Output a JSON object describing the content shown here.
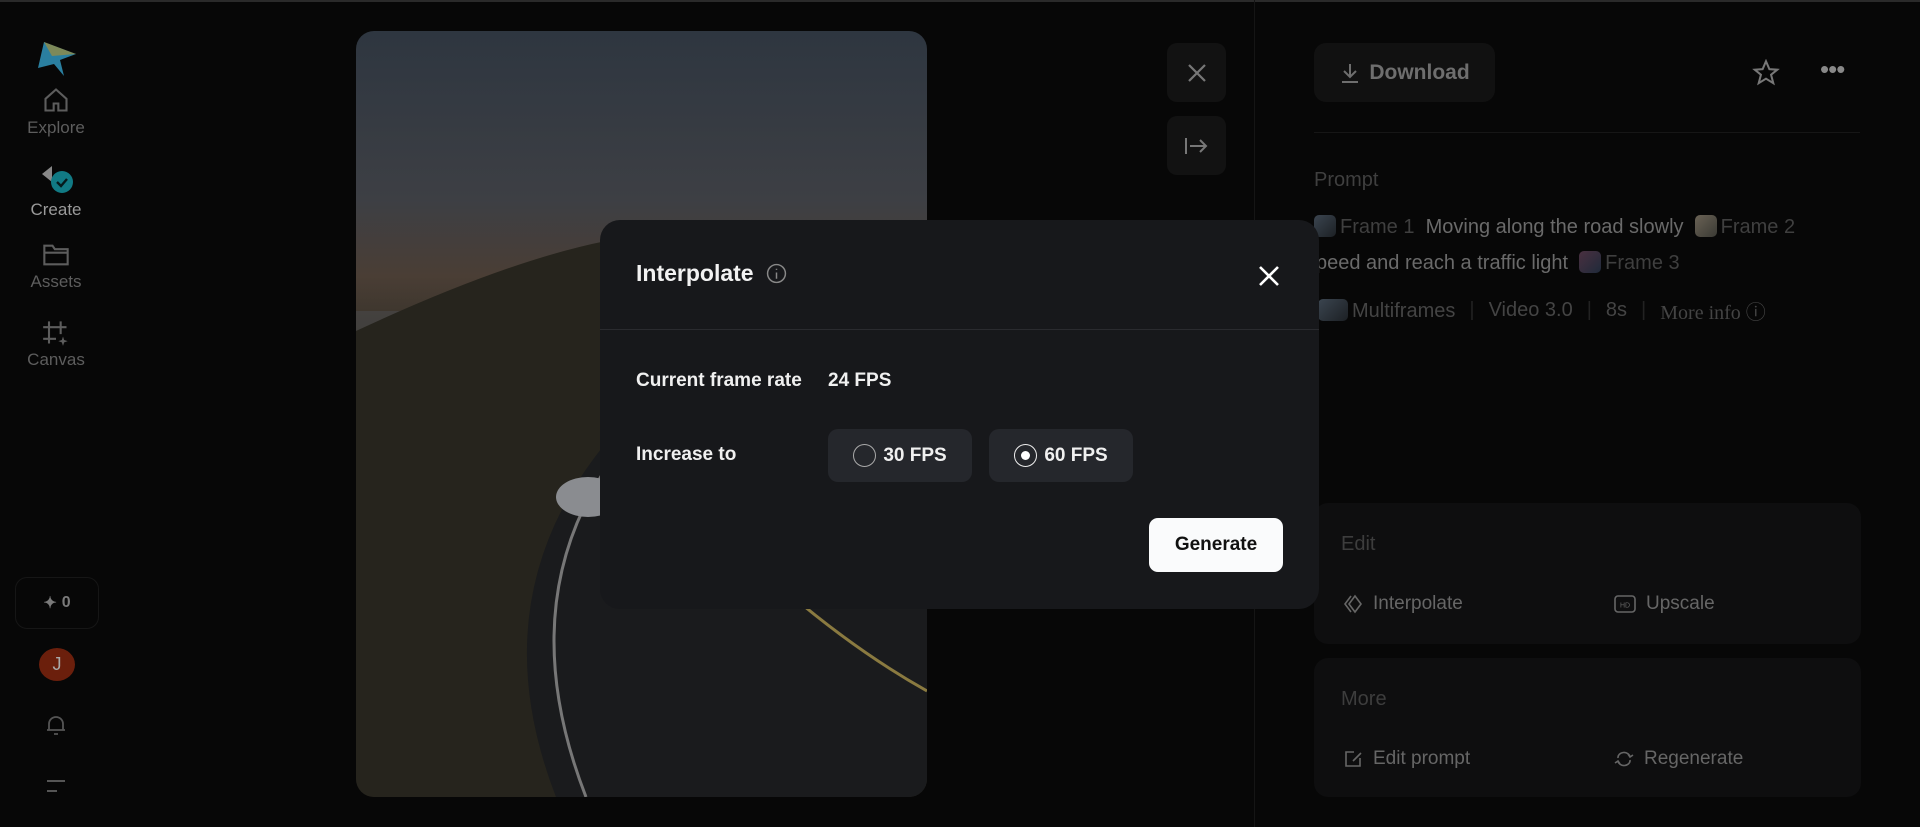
{
  "sidebar": {
    "items": [
      {
        "label": "Explore"
      },
      {
        "label": "Create"
      },
      {
        "label": "Assets"
      },
      {
        "label": "Canvas"
      }
    ],
    "credits": "0",
    "avatar_initial": "J"
  },
  "panel": {
    "download": "Download",
    "prompt_label": "Prompt",
    "prompt": {
      "frame1": "Frame 1",
      "text1": "Moving along the road slowly",
      "frame2": "Frame 2",
      "text2": "speed and reach a traffic light",
      "frame3": "Frame 3"
    },
    "meta": {
      "mode": "Multiframes",
      "model": "Video 3.0",
      "duration": "8s",
      "more": "More info"
    },
    "edit": {
      "title": "Edit",
      "interpolate": "Interpolate",
      "upscale": "Upscale"
    },
    "more": {
      "title": "More",
      "edit_prompt": "Edit prompt",
      "regenerate": "Regenerate"
    }
  },
  "dialog": {
    "title": "Interpolate",
    "current_label": "Current frame rate",
    "current_value": "24 FPS",
    "increase_label": "Increase to",
    "options": [
      {
        "label": "30 FPS",
        "selected": false
      },
      {
        "label": "60 FPS",
        "selected": true
      }
    ],
    "generate": "Generate"
  }
}
